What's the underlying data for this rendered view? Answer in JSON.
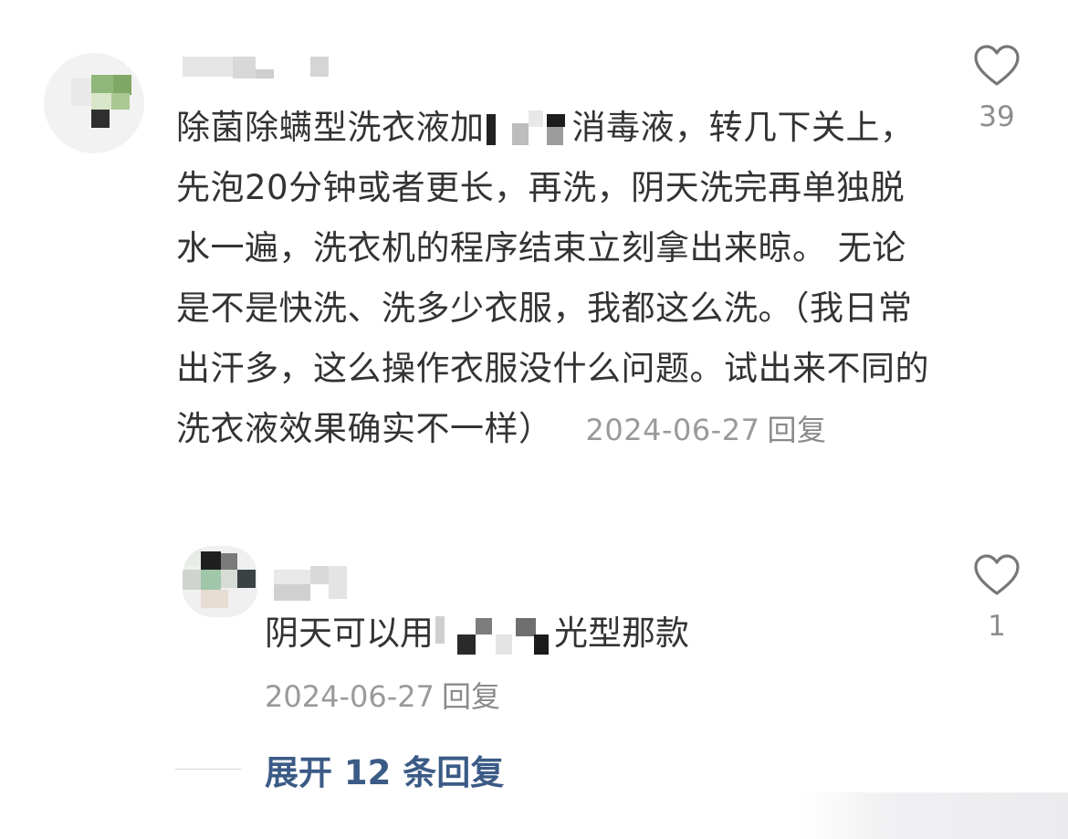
{
  "comment": {
    "text_before": "除菌除螨型洗衣液加",
    "text_after": "消毒液，转几下关上，先泡20分钟或者更长，再洗，阴天洗完再单独脱水一遍，洗衣机的程序结束立刻拿出来晾。 无论是不是快洗、洗多少衣服，我都这么洗。（我日常出汗多，这么操作衣服没什么问题。试出来不同的洗衣液效果确实不一样）",
    "date": "2024-06-27",
    "reply_label": "回复",
    "like_count": "39"
  },
  "reply": {
    "text_before": "阴天可以用",
    "text_after": "光型那款",
    "date": "2024-06-27",
    "reply_label": "回复",
    "like_count": "1"
  },
  "expand": {
    "label": "展开 12 条回复"
  },
  "colors": {
    "text": "#333333",
    "meta": "#9a9a9a",
    "link": "#3b5b86",
    "icon": "#777777"
  },
  "icons": [
    "heart-outline-icon"
  ]
}
